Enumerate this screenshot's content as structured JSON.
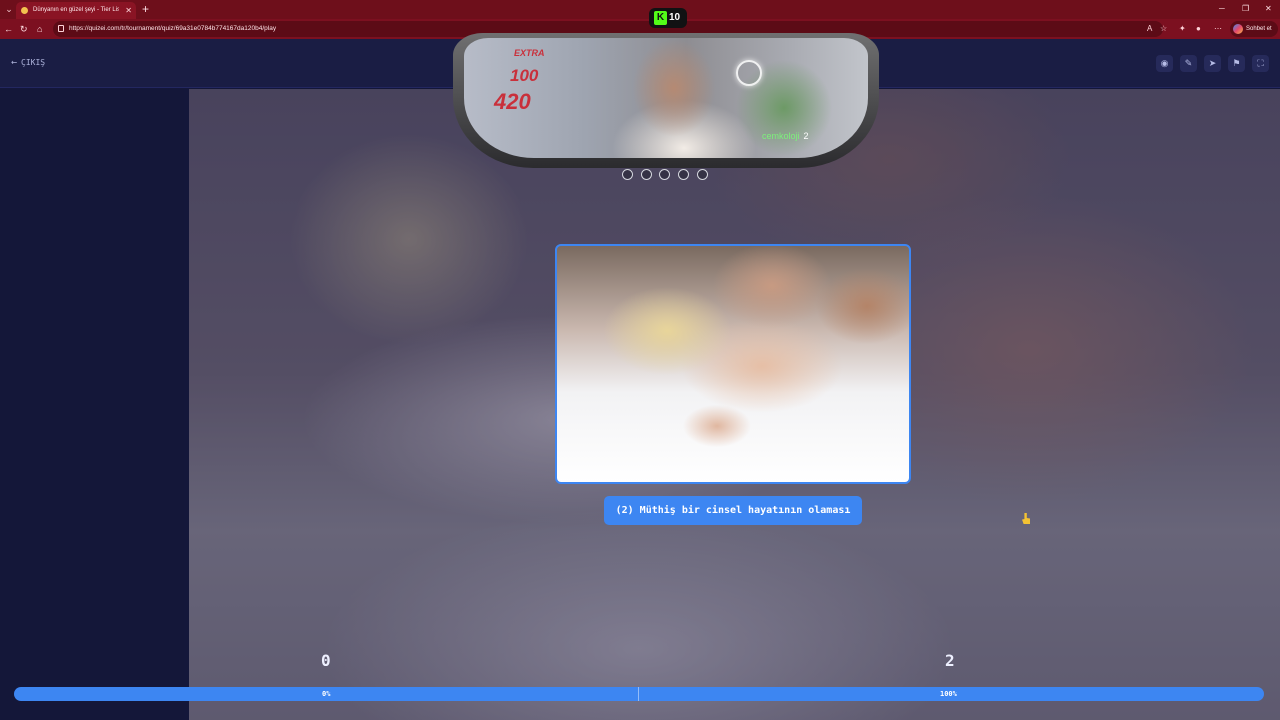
{
  "browser": {
    "tab_title": "Dünyanın en güzel şeyi - Tier List…",
    "tab_close": "✕",
    "new_tab": "+",
    "url": "https://quizei.com/tr/tournament/quiz/69a31e0784b774167da120b4/play",
    "copilot_label": "Sohbet et"
  },
  "header": {
    "exit_arrow": "←",
    "exit_label": "ÇIKIŞ",
    "tools": [
      "eye-icon",
      "pencil-icon",
      "send-icon",
      "flag-icon",
      "fullscreen-icon"
    ]
  },
  "overlay": {
    "badge_letter": "K",
    "badge_value": "10",
    "extra_label": "EXTRA",
    "stat_1": "100",
    "stat_2": "420",
    "chat_user": "cemkoloji",
    "chat_text": "2"
  },
  "card": {
    "caption": "(2) Müthiş bir cinsel hayatının olaması"
  },
  "scores": {
    "left": "0",
    "right": "2"
  },
  "progress": {
    "left_pct": "0%",
    "right_pct": "100%",
    "left_fraction": 0.0,
    "right_fraction": 1.0
  },
  "colors": {
    "accent": "#3d86f2",
    "chrome": "#7c1020",
    "page_bg": "#14173a"
  }
}
